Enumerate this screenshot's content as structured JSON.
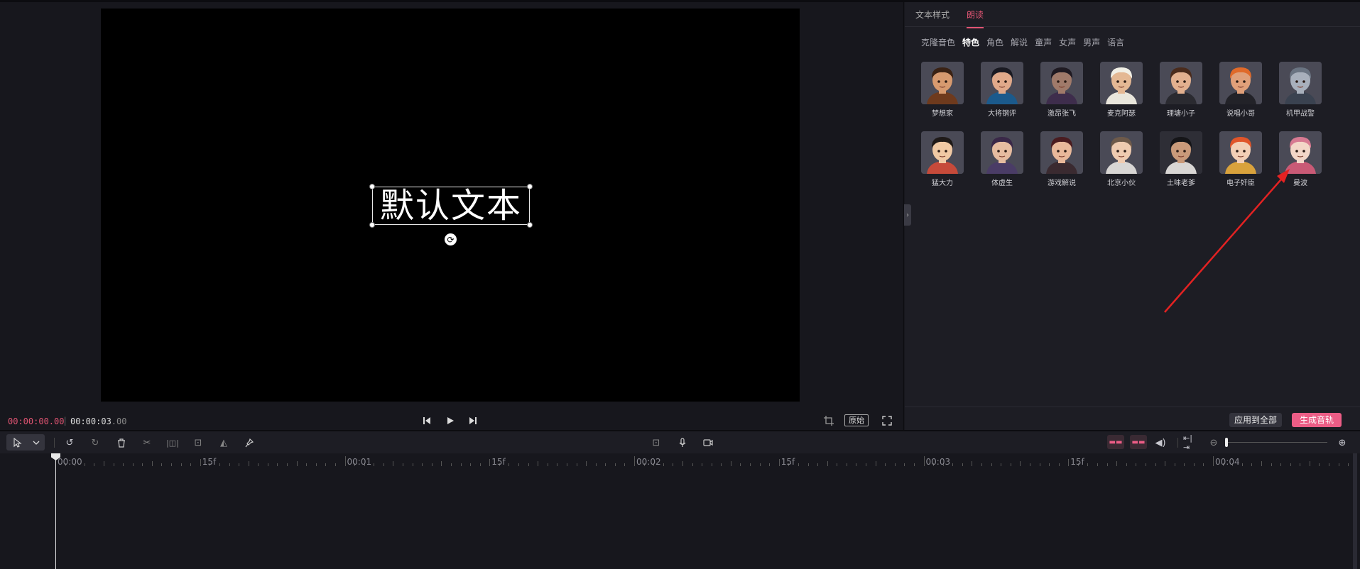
{
  "preview": {
    "text_content": "默认文本",
    "current_time": "00:00:00.00",
    "total_time_main": "00:00:03",
    "total_time_frac": ".00",
    "ratio_label": "原始"
  },
  "panel": {
    "tabs": [
      {
        "label": "文本样式",
        "active": false
      },
      {
        "label": "朗读",
        "active": true
      }
    ],
    "categories": [
      {
        "label": "克隆音色",
        "active": false
      },
      {
        "label": "特色",
        "active": true
      },
      {
        "label": "角色",
        "active": false
      },
      {
        "label": "解说",
        "active": false
      },
      {
        "label": "童声",
        "active": false
      },
      {
        "label": "女声",
        "active": false
      },
      {
        "label": "男声",
        "active": false
      },
      {
        "label": "语言",
        "active": false
      }
    ],
    "voices": [
      {
        "name": "梦想家",
        "skin": "#d79a6f",
        "hair": "#3a2214",
        "shirt": "#6e3a1d",
        "bg": "#4a4a56"
      },
      {
        "name": "大将钢评",
        "skin": "#e0a98a",
        "hair": "#1a1a22",
        "shirt": "#1b5a8c",
        "bg": "#4a4a56"
      },
      {
        "name": "激昂张飞",
        "skin": "#a07a6a",
        "hair": "#1f1a22",
        "shirt": "#3e2d4c",
        "bg": "#4a4a56"
      },
      {
        "name": "麦克阿瑟",
        "skin": "#e4b894",
        "hair": "#f1efe6",
        "shirt": "#e9e6dc",
        "bg": "#4a4a56"
      },
      {
        "name": "理塘小子",
        "skin": "#e2b08f",
        "hair": "#4a2b1c",
        "shirt": "#2a2a30",
        "bg": "#4a4a56"
      },
      {
        "name": "说唱小哥",
        "skin": "#e0a07a",
        "hair": "#e06a2a",
        "shirt": "#222228",
        "bg": "#4a4a56"
      },
      {
        "name": "机甲战警",
        "skin": "#a8b0bc",
        "hair": "#6a7482",
        "shirt": "#3a4250",
        "bg": "#4a4a56"
      },
      {
        "name": "猛大力",
        "skin": "#f0c9a4",
        "hair": "#1f1a18",
        "shirt": "#c64a3a",
        "bg": "#4a4a56"
      },
      {
        "name": "体虚生",
        "skin": "#e6bca0",
        "hair": "#3a2848",
        "shirt": "#4a3c66",
        "bg": "#4a4a56"
      },
      {
        "name": "游戏解说",
        "skin": "#e8b89a",
        "hair": "#4a1c20",
        "shirt": "#3a2a30",
        "bg": "#4a4a56"
      },
      {
        "name": "北京小伙",
        "skin": "#efcbb0",
        "hair": "#6e5a4a",
        "shirt": "#d8d6d4",
        "bg": "#4a4a56"
      },
      {
        "name": "土味老爹",
        "skin": "#c99a7a",
        "hair": "#151518",
        "shirt": "#d8d6d4",
        "bg": "#2e2e36"
      },
      {
        "name": "电子奸臣",
        "skin": "#f2cfb6",
        "hair": "#e0552a",
        "shirt": "#d9a23c",
        "bg": "#4a4a56"
      },
      {
        "name": "曼波",
        "skin": "#f3d6c8",
        "hair": "#d77a92",
        "shirt": "#c95a76",
        "bg": "#4a4a56"
      }
    ],
    "apply_all_label": "应用到全部",
    "generate_label": "生成音轨"
  },
  "timeline": {
    "labels": [
      "00:00",
      "15f",
      "00:01",
      "15f",
      "00:02",
      "15f",
      "00:03",
      "15f",
      "00:04"
    ]
  },
  "colors": {
    "accent": "#ec5d86",
    "annotation_arrow": "#e32222"
  }
}
